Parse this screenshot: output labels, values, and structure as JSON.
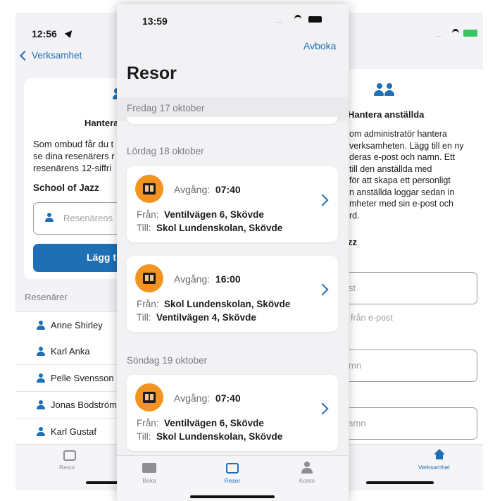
{
  "left": {
    "status_time": "12:56",
    "back_label": "Verksamhet",
    "card_title": "Hantera",
    "card_body": [
      "Som ombud får du t",
      "se dina resenärers r",
      "resenärens 12-siffri"
    ],
    "org_name": "School of Jazz",
    "input_placeholder": "Resenärens",
    "add_button": "Lägg t",
    "section_header": "Resenärer",
    "travelers": [
      "Anne Shirley",
      "Karl Anka",
      "Pelle Svensson",
      "Jonas Bodström",
      "Karl Gustaf"
    ],
    "tab_label": "Resor"
  },
  "middle": {
    "status_time": "13:59",
    "cancel_label": "Avboka",
    "title": "Resor",
    "sections": [
      "Fredag 17 oktober",
      "Lördag 18 oktober",
      "Söndag 19 oktober"
    ],
    "trips": [
      {
        "dep_label": "Avgång:",
        "dep_time": "07:40",
        "from_label": "Från:",
        "from": "Ventilvägen 6, Skövde",
        "to_label": "Till:",
        "to": "Skol Lundenskolan, Skövde"
      },
      {
        "dep_label": "Avgång:",
        "dep_time": "16:00",
        "from_label": "Från:",
        "from": "Skol Lundenskolan, Skövde",
        "to_label": "Till:",
        "to": "Ventilvägen 4, Skövde"
      },
      {
        "dep_label": "Avgång:",
        "dep_time": "07:40",
        "from_label": "Från:",
        "from": "Ventilvägen 6, Skövde",
        "to_label": "Till:",
        "to": "Skol Lundenskolan, Skövde"
      }
    ],
    "tabs": [
      {
        "label": "Boka",
        "active": false
      },
      {
        "label": "Resor",
        "active": true
      },
      {
        "label": "Konto",
        "active": false
      }
    ]
  },
  "right": {
    "card_title": "Hantera anställda",
    "card_body": [
      "om administratör hantera",
      "verksamheten. Lägg till en ny",
      "deras e-post och namn. Ett",
      "till den anställda med",
      "för att skapa ett personligt",
      "n anställda loggar sedan in",
      "mheter med sin e-post och",
      "rd."
    ],
    "org_name": "zz",
    "field1_placeholder": "st",
    "field1_hint": "från e-post",
    "field2_placeholder": "mn",
    "field3_placeholder": "namn",
    "tab_label": "Verksamhet"
  },
  "colors": {
    "accent": "#1f6fb5",
    "badge": "#f39322",
    "background": "#f2f2f7"
  }
}
